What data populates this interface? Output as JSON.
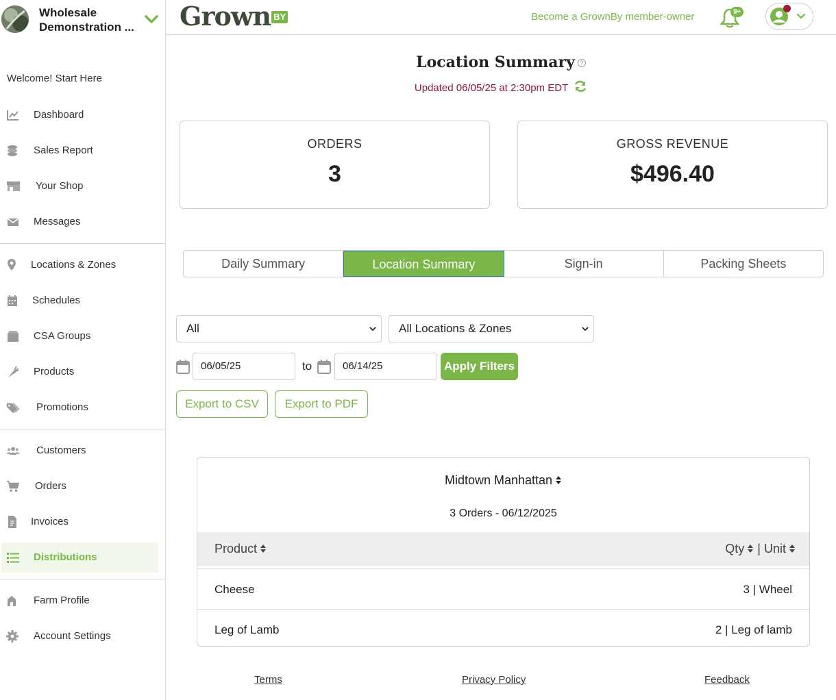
{
  "sidebar": {
    "farm_name_line1": "Wholesale",
    "farm_name_line2": "Demonstration ...",
    "welcome": "Welcome! Start Here",
    "items": [
      {
        "label": "Dashboard",
        "icon": "chart-line-icon"
      },
      {
        "label": "Sales Report",
        "icon": "coins-icon"
      },
      {
        "label": "Your Shop",
        "icon": "store-icon"
      },
      {
        "label": "Messages",
        "icon": "envelope-icon"
      },
      {
        "label": "Locations & Zones",
        "icon": "map-pin-icon"
      },
      {
        "label": "Schedules",
        "icon": "calendar-icon"
      },
      {
        "label": "CSA Groups",
        "icon": "box-icon"
      },
      {
        "label": "Products",
        "icon": "carrot-icon"
      },
      {
        "label": "Promotions",
        "icon": "tags-icon"
      },
      {
        "label": "Customers",
        "icon": "users-icon"
      },
      {
        "label": "Orders",
        "icon": "cart-icon"
      },
      {
        "label": "Invoices",
        "icon": "invoice-icon"
      },
      {
        "label": "Distributions",
        "icon": "list-icon",
        "active": true
      },
      {
        "label": "Farm Profile",
        "icon": "farm-icon"
      },
      {
        "label": "Account Settings",
        "icon": "gear-icon"
      }
    ]
  },
  "topbar": {
    "logo_text": "Grown",
    "logo_by": "BY",
    "member_link": "Become a GrownBy member-owner",
    "notification_badge": "9+"
  },
  "main": {
    "title": "Location Summary",
    "help": "?",
    "updated": "Updated 06/05/25 at 2:30pm EDT",
    "cards": {
      "orders_label": "ORDERS",
      "orders_value": "3",
      "revenue_label": "GROSS REVENUE",
      "revenue_value": "$496.40"
    },
    "tabs": [
      "Daily Summary",
      "Location Summary",
      "Sign-in",
      "Packing Sheets"
    ],
    "active_tab": "Location Summary",
    "filters": {
      "type_select": "All",
      "location_select": "All Locations & Zones",
      "date_from": "06/05/25",
      "to_label": "to",
      "date_to": "06/14/25",
      "apply": "Apply Filters",
      "export_csv": "Export to CSV",
      "export_pdf": "Export to PDF"
    },
    "location": {
      "name": "Midtown Manhattan",
      "subtitle": "3 Orders - 06/12/2025",
      "col_product": "Product",
      "col_qty": "Qty",
      "col_sep": "|",
      "col_unit": "Unit",
      "rows": [
        {
          "product": "Cheese",
          "qty_unit": "3 | Wheel"
        },
        {
          "product": "Leg of Lamb",
          "qty_unit": "2 | Leg of lamb"
        }
      ]
    }
  },
  "footer": {
    "terms": "Terms",
    "privacy": "Privacy Policy",
    "feedback": "Feedback"
  },
  "colors": {
    "accent": "#7ab648",
    "updated_text": "#8b1a3a",
    "notification_dot": "#9b1b3a"
  }
}
